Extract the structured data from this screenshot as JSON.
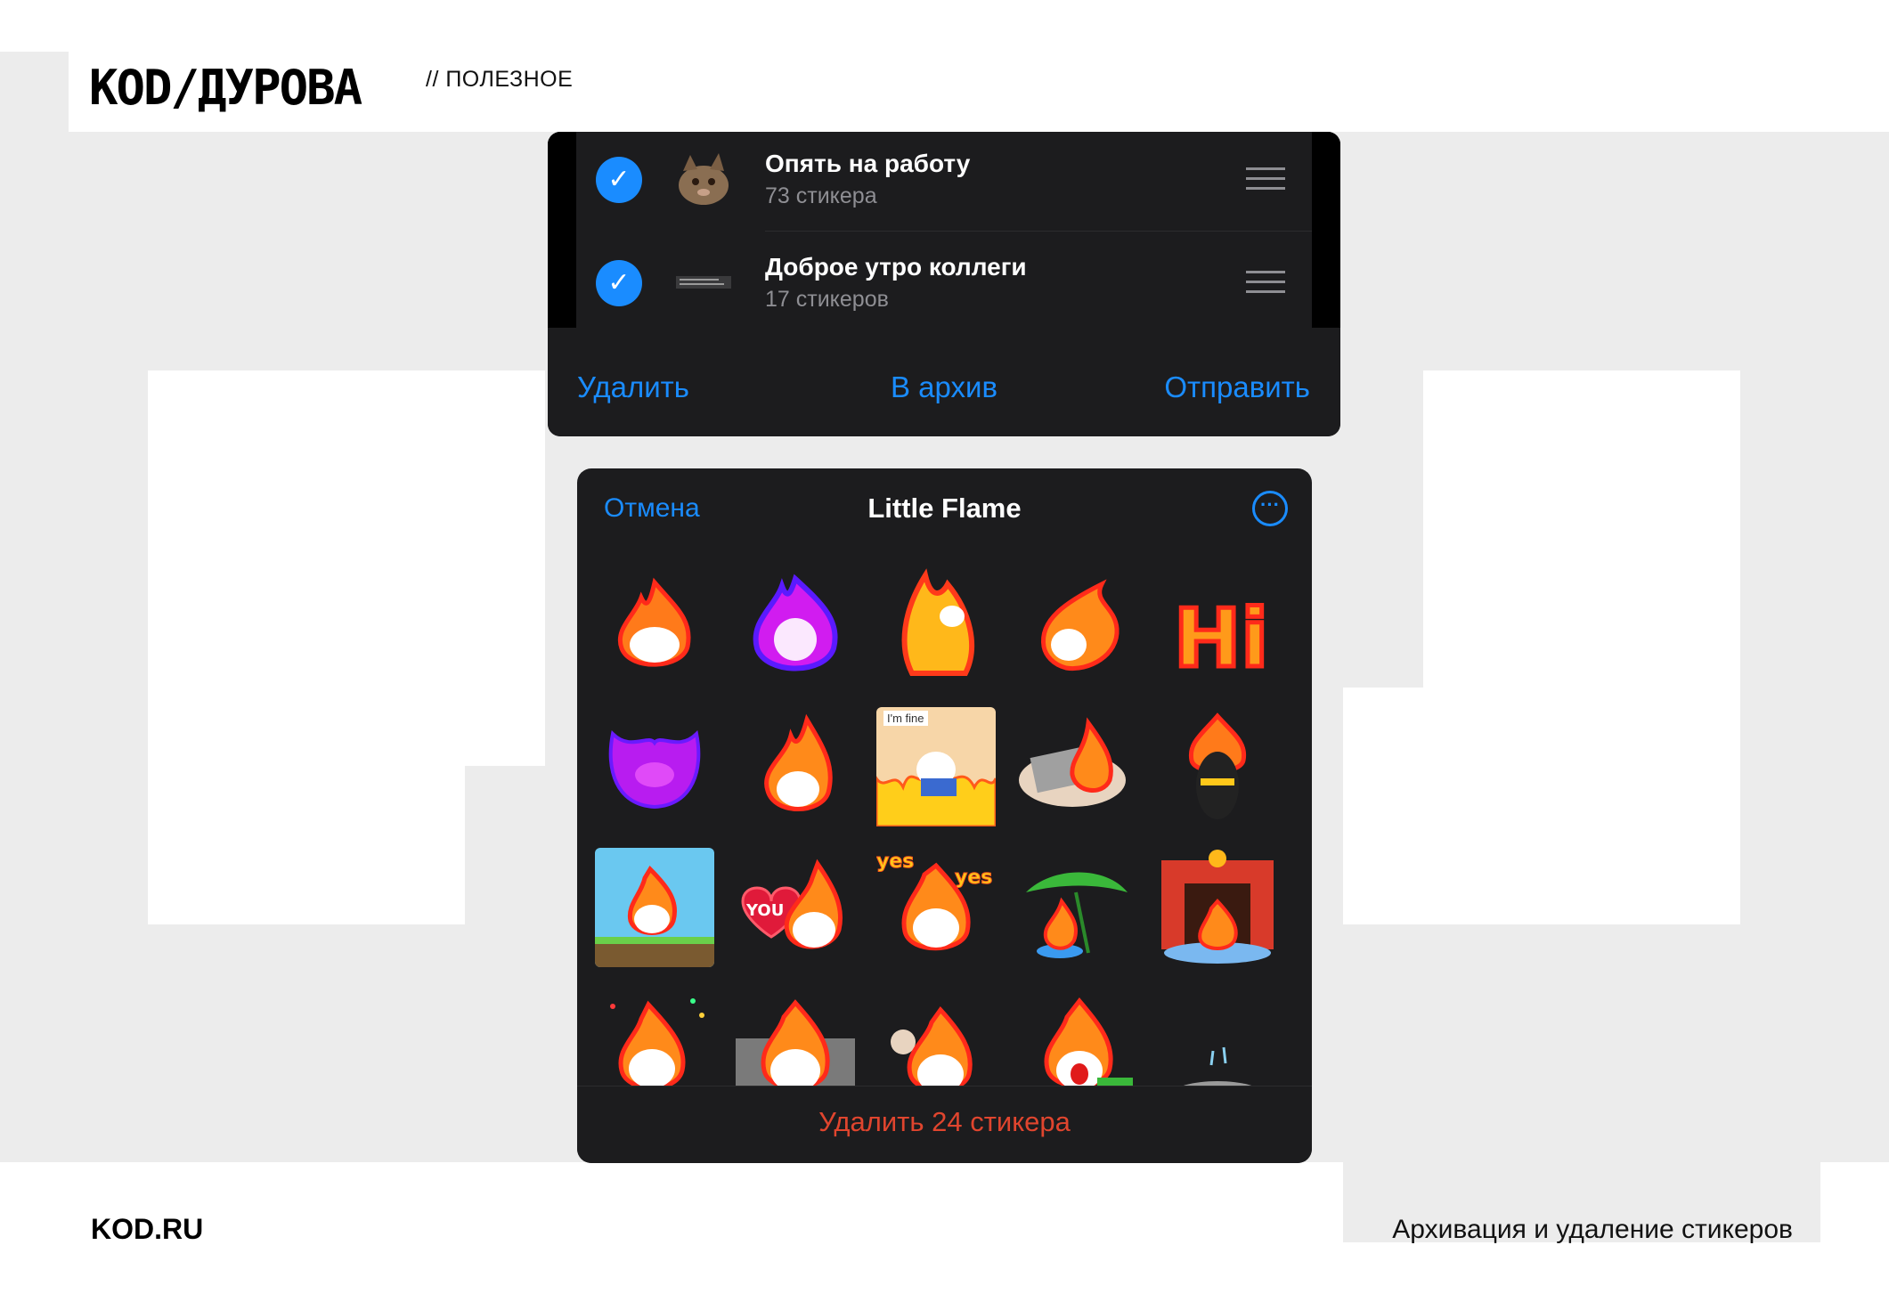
{
  "brand": {
    "logo": "KOD/ДУРОВА",
    "section": "// ПОЛЕЗНОЕ",
    "site": "KOD.RU",
    "caption": "Архивация и удаление стикеров"
  },
  "sticker_list": {
    "rows": [
      {
        "title": "Опять на работу",
        "count": "73 стикера",
        "checked": true
      },
      {
        "title": "Доброе утро коллеги",
        "count": "17 стикеров",
        "checked": true
      }
    ],
    "toolbar": {
      "delete": "Удалить",
      "archive": "В архив",
      "send": "Отправить"
    }
  },
  "sticker_pack": {
    "cancel": "Отмена",
    "title": "Little Flame",
    "more_icon": "ellipsis-circle-icon",
    "delete_button": "Удалить 24 стикера",
    "sticker_labels": [
      "I'm fine",
      "YOU",
      "yes",
      "yes",
      "Hi"
    ]
  },
  "colors": {
    "accent": "#1a8cff",
    "destructive": "#e0452e",
    "panel": "#1c1c1e"
  }
}
